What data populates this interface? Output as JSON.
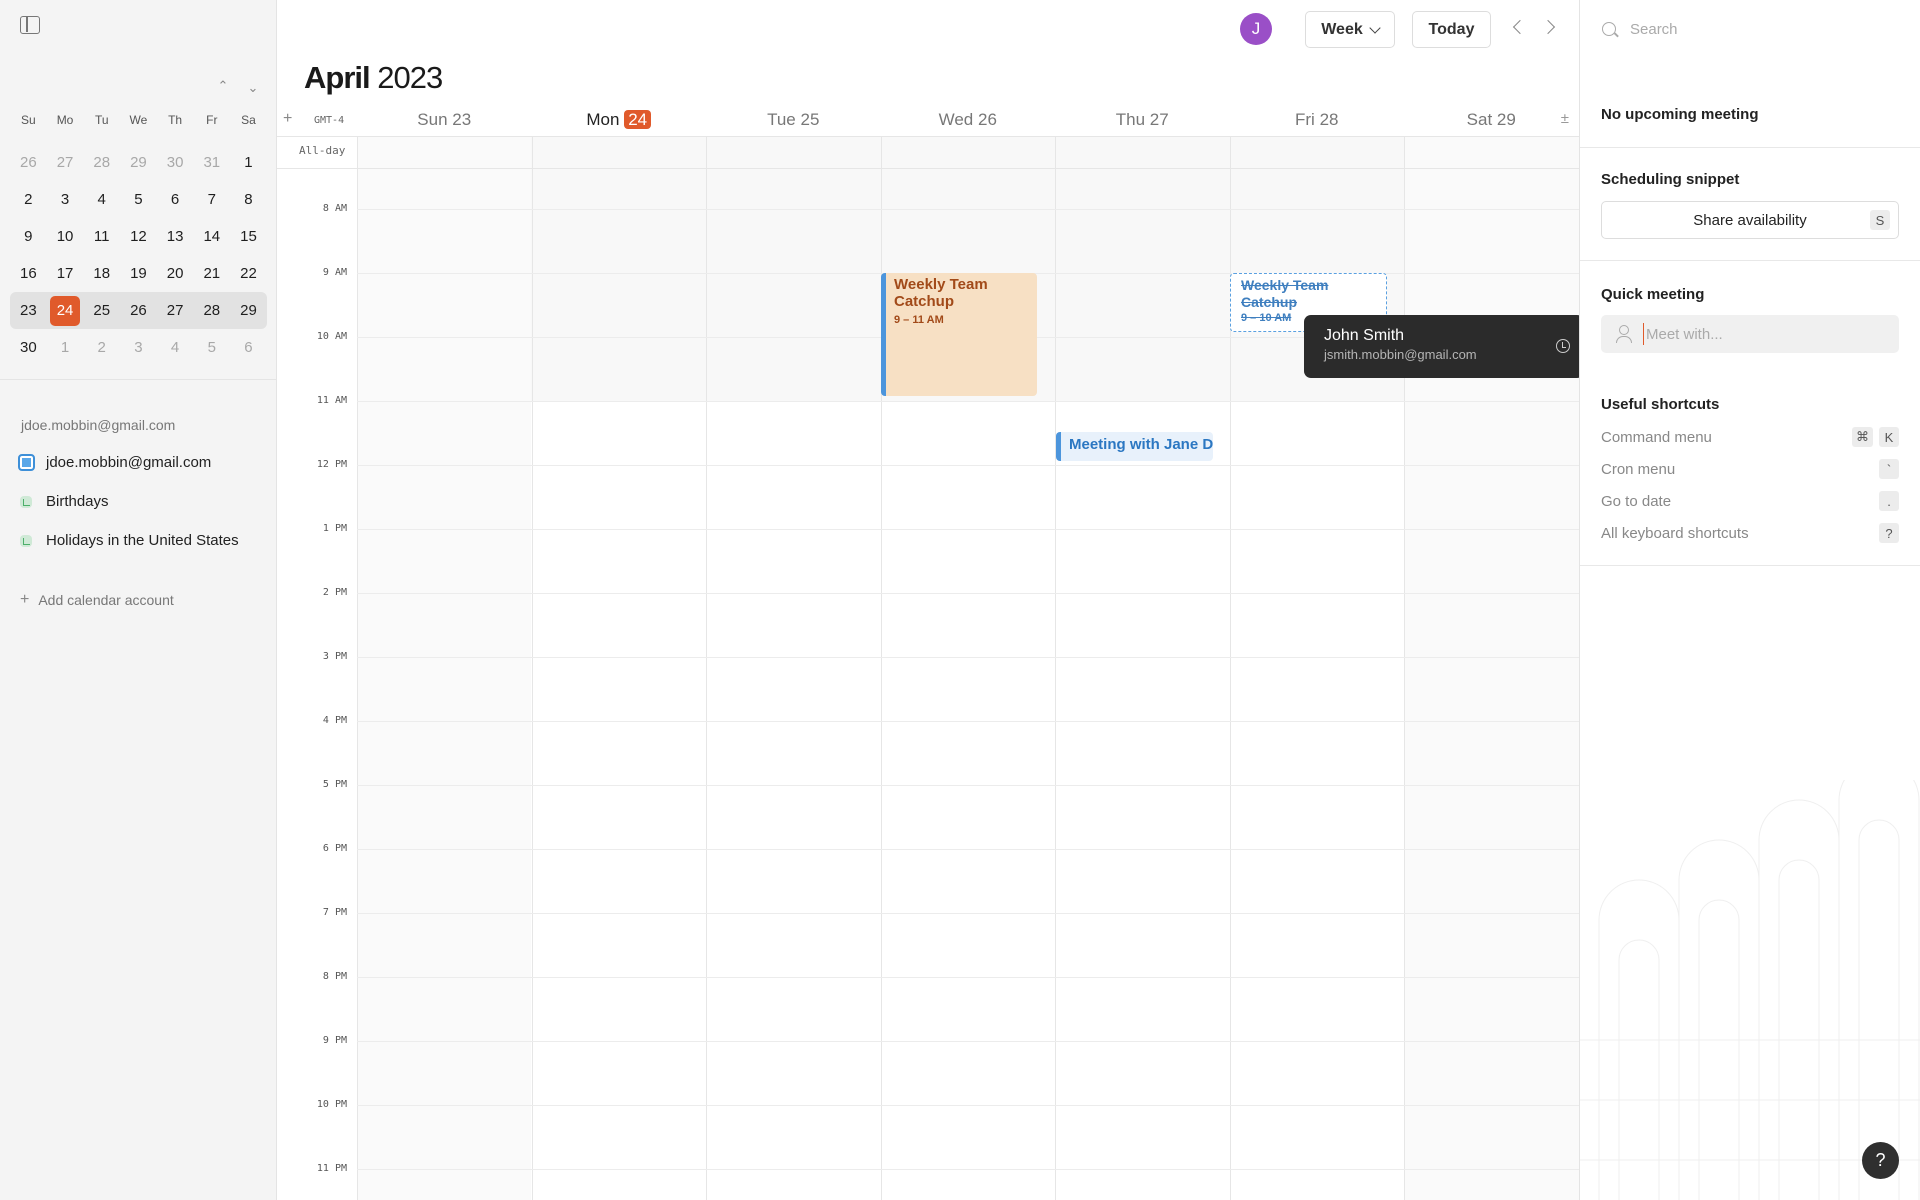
{
  "mini_calendar": {
    "weekdays": [
      "Su",
      "Mo",
      "Tu",
      "We",
      "Th",
      "Fr",
      "Sa"
    ],
    "rows": [
      [
        "26",
        "27",
        "28",
        "29",
        "30",
        "31",
        "1"
      ],
      [
        "2",
        "3",
        "4",
        "5",
        "6",
        "7",
        "8"
      ],
      [
        "9",
        "10",
        "11",
        "12",
        "13",
        "14",
        "15"
      ],
      [
        "16",
        "17",
        "18",
        "19",
        "20",
        "21",
        "22"
      ],
      [
        "23",
        "24",
        "25",
        "26",
        "27",
        "28",
        "29"
      ],
      [
        "30",
        "1",
        "2",
        "3",
        "4",
        "5",
        "6"
      ]
    ],
    "today": "24"
  },
  "accounts": {
    "email_header": "jdoe.mobbin@gmail.com",
    "calendars": [
      {
        "label": "jdoe.mobbin@gmail.com",
        "color": "#3d8fd8"
      },
      {
        "label": "Birthdays",
        "color": "#4caf6a"
      },
      {
        "label": "Holidays in the United States",
        "color": "#4caf6a"
      }
    ],
    "add_label": "Add calendar account"
  },
  "toolbar": {
    "avatar_initial": "J",
    "view_label": "Week",
    "today_label": "Today"
  },
  "header": {
    "month": "April",
    "year": "2023",
    "timezone": "GMT-4",
    "add_symbol": "+",
    "collapse_symbol": "±",
    "allday_label": "All-day"
  },
  "days": [
    {
      "name": "Sun",
      "num": "23"
    },
    {
      "name": "Mon",
      "num": "24"
    },
    {
      "name": "Tue",
      "num": "25"
    },
    {
      "name": "Wed",
      "num": "26"
    },
    {
      "name": "Thu",
      "num": "27"
    },
    {
      "name": "Fri",
      "num": "28"
    },
    {
      "name": "Sat",
      "num": "29"
    }
  ],
  "hours": [
    "8 AM",
    "9 AM",
    "10 AM",
    "11 AM",
    "12 PM",
    "1 PM",
    "2 PM",
    "3 PM",
    "4 PM",
    "5 PM",
    "6 PM",
    "7 PM",
    "8 PM",
    "9 PM",
    "10 PM",
    "11 PM"
  ],
  "events": {
    "weekly": {
      "title": "Weekly Team Catchup",
      "time": "9 – 11 AM"
    },
    "ghost": {
      "title": "Weekly Team Catchup",
      "time": "9 – 10 AM"
    },
    "jane": {
      "title": "Meeting with Jane D"
    }
  },
  "tooltip": {
    "name": "John Smith",
    "email": "jsmith.mobbin@gmail.com"
  },
  "right_panel": {
    "search_placeholder": "Search",
    "upcoming": "No upcoming meeting",
    "snippet_title": "Scheduling snippet",
    "share_label": "Share availability",
    "share_key": "S",
    "quick_title": "Quick meeting",
    "meet_placeholder": "Meet with...",
    "shortcuts_title": "Useful shortcuts",
    "shortcuts": [
      {
        "label": "Command menu",
        "keys": [
          "⌘",
          "K"
        ]
      },
      {
        "label": "Cron menu",
        "keys": [
          "`"
        ]
      },
      {
        "label": "Go to date",
        "keys": [
          "."
        ]
      },
      {
        "label": "All keyboard shortcuts",
        "keys": [
          "?"
        ]
      }
    ]
  },
  "help_label": "?"
}
